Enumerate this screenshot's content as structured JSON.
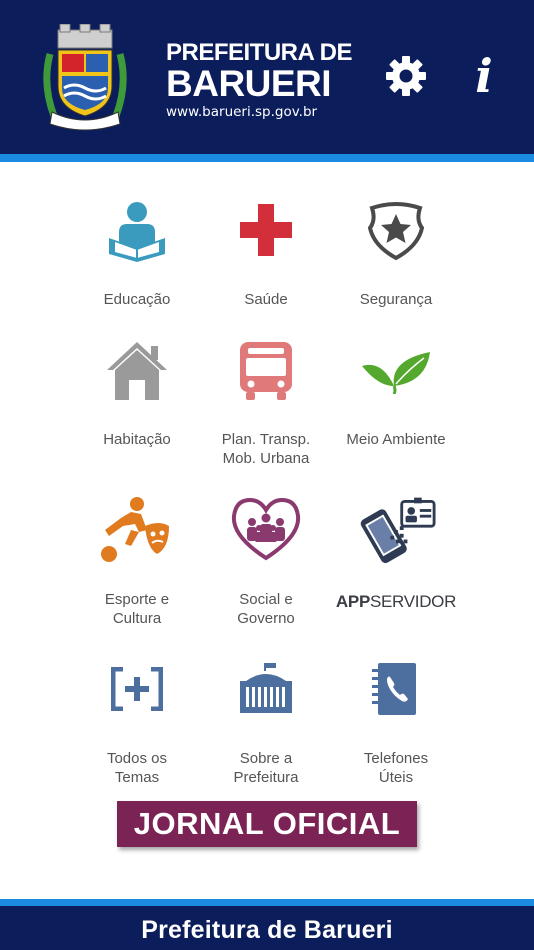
{
  "header": {
    "brand_line1": "PREFEITURA DE",
    "brand_line2": "BARUERI",
    "url": "www.barueri.sp.gov.br",
    "crest_text": "BARUERI",
    "settings_icon": "gear-icon",
    "info_icon": "info-icon",
    "info_glyph": "i"
  },
  "colors": {
    "header_bg": "#0b1d5a",
    "stripe": "#1a8be0",
    "label": "#555555",
    "jornal_bg": "#7b2355"
  },
  "tiles": [
    {
      "label": "Educação",
      "icon": "reading-person-icon",
      "color": "#3a9bbf"
    },
    {
      "label": "Saúde",
      "icon": "red-cross-icon",
      "color": "#d32f3a"
    },
    {
      "label": "Segurança",
      "icon": "police-badge-icon",
      "color": "#4a4a4a"
    },
    {
      "label": "Habitação",
      "icon": "house-icon",
      "color": "#9a9a9a"
    },
    {
      "label": "Plan. Transp.\nMob. Urbana",
      "icon": "bus-icon",
      "color": "#e07a7a"
    },
    {
      "label": "Meio Ambiente",
      "icon": "leaves-icon",
      "color": "#55a82e"
    },
    {
      "label": "Esporte e\nCultura",
      "icon": "sport-culture-icon",
      "color": "#e07b1f"
    },
    {
      "label": "Social e\nGoverno",
      "icon": "social-heart-icon",
      "color": "#8a3a6e"
    },
    {
      "label_bold": "APP",
      "label_rest": "SERVIDOR",
      "icon": "phone-badge-icon",
      "color": "#2f3b52"
    },
    {
      "label": "Todos os\nTemas",
      "icon": "bracket-plus-icon",
      "color": "#4d6fa0"
    },
    {
      "label": "Sobre a\nPrefeitura",
      "icon": "city-hall-icon",
      "color": "#4d6fa0"
    },
    {
      "label": "Telefones\nÚteis",
      "icon": "phone-book-icon",
      "color": "#4d6fa0"
    }
  ],
  "jornal": {
    "label": "JORNAL OFICIAL"
  },
  "footer": {
    "label": "Prefeitura de Barueri"
  }
}
